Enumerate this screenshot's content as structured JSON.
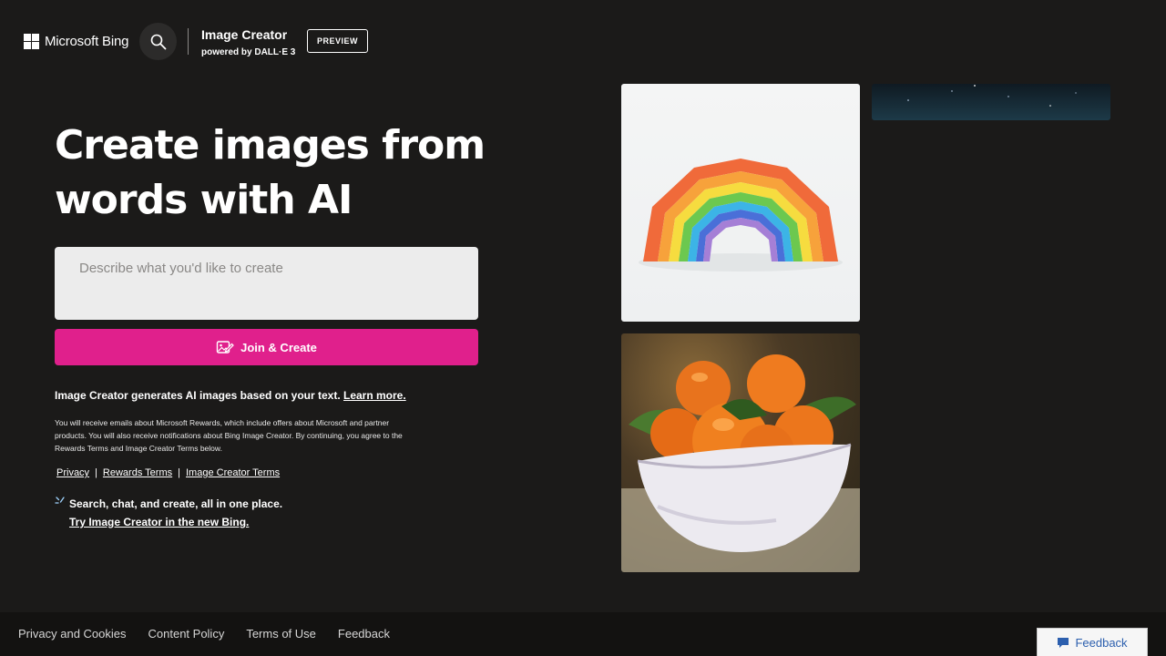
{
  "header": {
    "brand": "Microsoft Bing",
    "product_title": "Image Creator",
    "product_sub_prefix": "powered by ",
    "product_sub_model": "DALL·E 3",
    "preview_badge": "PREVIEW"
  },
  "hero": {
    "title_line1": "Create images from",
    "title_line2": "words with AI"
  },
  "prompt": {
    "placeholder": "Describe what you'd like to create",
    "value": ""
  },
  "join_button": {
    "label": "Join & Create"
  },
  "info": {
    "text": "Image Creator generates AI images based on your text. ",
    "learn_more": "Learn more."
  },
  "fine_print": "You will receive emails about Microsoft Rewards, which include offers about Microsoft and partner products. You will also receive notifications about Bing Image Creator. By continuing, you agree to the Rewards Terms and Image Creator Terms below.",
  "terms_links": {
    "privacy": "Privacy",
    "rewards": "Rewards Terms",
    "image_creator": "Image Creator Terms",
    "separator": "|"
  },
  "promo": {
    "line1": "Search, chat, and create, all in one place.",
    "line2": "Try Image Creator in the new Bing."
  },
  "gallery": {
    "images": [
      "rainbow-image",
      "starry-sky-image",
      "oranges-bowl-image"
    ]
  },
  "footer": {
    "links": [
      "Privacy and Cookies",
      "Content Policy",
      "Terms of Use",
      "Feedback"
    ]
  },
  "feedback_button": {
    "label": "Feedback"
  },
  "colors": {
    "background": "#1b1a19",
    "accent": "#e0208c",
    "footer_bg": "#131211",
    "feedback_text": "#2c5fae"
  },
  "icons": {
    "logo": "microsoft-logo-icon",
    "search": "search-icon",
    "join": "image-edit-icon",
    "promo": "sparkle-icon",
    "feedback": "chat-bubble-icon"
  }
}
